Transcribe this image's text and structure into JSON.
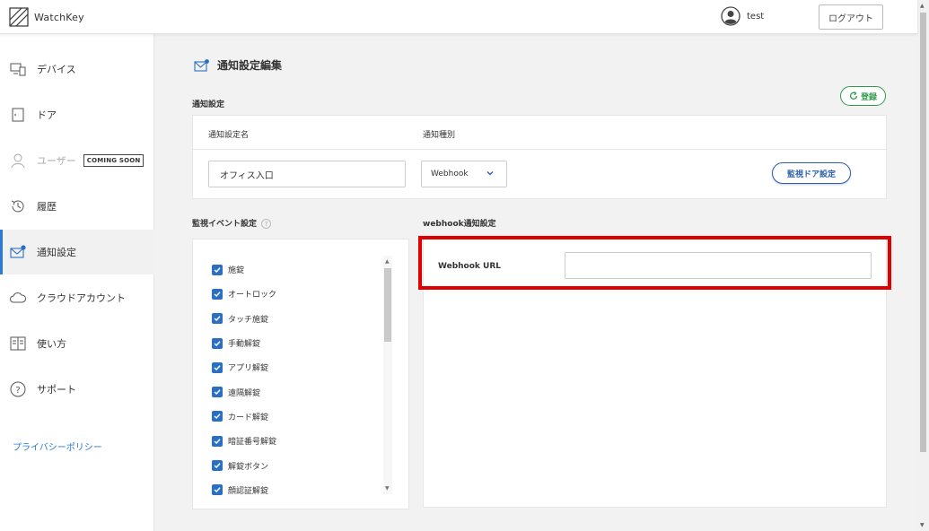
{
  "app": {
    "name": "WatchKey",
    "user": "test",
    "logout_label": "ログアウト"
  },
  "sidebar": {
    "items": [
      {
        "label": "デバイス",
        "icon": "device-icon"
      },
      {
        "label": "ドア",
        "icon": "door-icon"
      },
      {
        "label": "ユーザー",
        "icon": "user-icon",
        "badge": "COMING SOON",
        "disabled": true
      },
      {
        "label": "履歴",
        "icon": "history-icon"
      },
      {
        "label": "通知設定",
        "icon": "mail-icon",
        "active": true
      },
      {
        "label": "クラウドアカウント",
        "icon": "cloud-icon"
      },
      {
        "label": "使い方",
        "icon": "book-icon"
      },
      {
        "label": "サポート",
        "icon": "help-icon"
      }
    ],
    "privacy_label": "プライバシーポリシー"
  },
  "page": {
    "title": "通知設定編集",
    "save_label": "登録",
    "notification_section": "通知設定",
    "col_name": "通知設定名",
    "col_type": "通知種別",
    "name_value": "オフィス入口",
    "type_value": "Webhook",
    "door_button": "監視ドア設定",
    "event_section": "監視イベント設定",
    "help_glyph": "?",
    "webhook_section": "webhook通知設定",
    "webhook_url_label": "Webhook URL",
    "webhook_url_value": ""
  },
  "events": [
    {
      "label": "施錠",
      "checked": true
    },
    {
      "label": "オートロック",
      "checked": true
    },
    {
      "label": "タッチ施錠",
      "checked": true
    },
    {
      "label": "手動解錠",
      "checked": true
    },
    {
      "label": "アプリ解錠",
      "checked": true
    },
    {
      "label": "遠隔解錠",
      "checked": true
    },
    {
      "label": "カード解錠",
      "checked": true
    },
    {
      "label": "暗証番号解錠",
      "checked": true
    },
    {
      "label": "解錠ボタン",
      "checked": true
    },
    {
      "label": "顔認証解錠",
      "checked": true
    }
  ],
  "colors": {
    "accent": "#2b7bd6",
    "save_green": "#2e9a4a",
    "checkbox_blue": "#2b6fc2",
    "highlight_red": "#e10000"
  }
}
